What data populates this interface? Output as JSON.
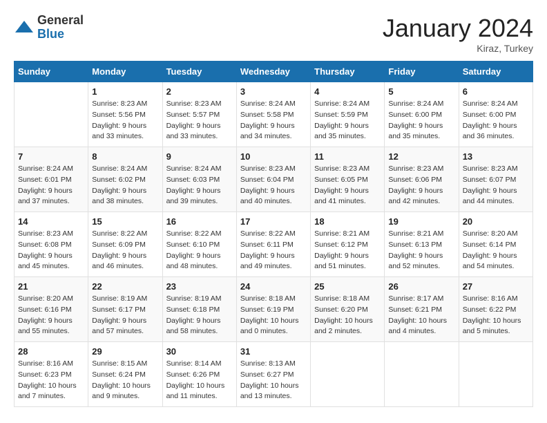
{
  "logo": {
    "general": "General",
    "blue": "Blue"
  },
  "title": "January 2024",
  "location": "Kiraz, Turkey",
  "days_of_week": [
    "Sunday",
    "Monday",
    "Tuesday",
    "Wednesday",
    "Thursday",
    "Friday",
    "Saturday"
  ],
  "weeks": [
    [
      {
        "day": "",
        "sunrise": "",
        "sunset": "",
        "daylight": ""
      },
      {
        "day": "1",
        "sunrise": "Sunrise: 8:23 AM",
        "sunset": "Sunset: 5:56 PM",
        "daylight": "Daylight: 9 hours and 33 minutes."
      },
      {
        "day": "2",
        "sunrise": "Sunrise: 8:23 AM",
        "sunset": "Sunset: 5:57 PM",
        "daylight": "Daylight: 9 hours and 33 minutes."
      },
      {
        "day": "3",
        "sunrise": "Sunrise: 8:24 AM",
        "sunset": "Sunset: 5:58 PM",
        "daylight": "Daylight: 9 hours and 34 minutes."
      },
      {
        "day": "4",
        "sunrise": "Sunrise: 8:24 AM",
        "sunset": "Sunset: 5:59 PM",
        "daylight": "Daylight: 9 hours and 35 minutes."
      },
      {
        "day": "5",
        "sunrise": "Sunrise: 8:24 AM",
        "sunset": "Sunset: 6:00 PM",
        "daylight": "Daylight: 9 hours and 35 minutes."
      },
      {
        "day": "6",
        "sunrise": "Sunrise: 8:24 AM",
        "sunset": "Sunset: 6:00 PM",
        "daylight": "Daylight: 9 hours and 36 minutes."
      }
    ],
    [
      {
        "day": "7",
        "sunrise": "Sunrise: 8:24 AM",
        "sunset": "Sunset: 6:01 PM",
        "daylight": "Daylight: 9 hours and 37 minutes."
      },
      {
        "day": "8",
        "sunrise": "Sunrise: 8:24 AM",
        "sunset": "Sunset: 6:02 PM",
        "daylight": "Daylight: 9 hours and 38 minutes."
      },
      {
        "day": "9",
        "sunrise": "Sunrise: 8:24 AM",
        "sunset": "Sunset: 6:03 PM",
        "daylight": "Daylight: 9 hours and 39 minutes."
      },
      {
        "day": "10",
        "sunrise": "Sunrise: 8:23 AM",
        "sunset": "Sunset: 6:04 PM",
        "daylight": "Daylight: 9 hours and 40 minutes."
      },
      {
        "day": "11",
        "sunrise": "Sunrise: 8:23 AM",
        "sunset": "Sunset: 6:05 PM",
        "daylight": "Daylight: 9 hours and 41 minutes."
      },
      {
        "day": "12",
        "sunrise": "Sunrise: 8:23 AM",
        "sunset": "Sunset: 6:06 PM",
        "daylight": "Daylight: 9 hours and 42 minutes."
      },
      {
        "day": "13",
        "sunrise": "Sunrise: 8:23 AM",
        "sunset": "Sunset: 6:07 PM",
        "daylight": "Daylight: 9 hours and 44 minutes."
      }
    ],
    [
      {
        "day": "14",
        "sunrise": "Sunrise: 8:23 AM",
        "sunset": "Sunset: 6:08 PM",
        "daylight": "Daylight: 9 hours and 45 minutes."
      },
      {
        "day": "15",
        "sunrise": "Sunrise: 8:22 AM",
        "sunset": "Sunset: 6:09 PM",
        "daylight": "Daylight: 9 hours and 46 minutes."
      },
      {
        "day": "16",
        "sunrise": "Sunrise: 8:22 AM",
        "sunset": "Sunset: 6:10 PM",
        "daylight": "Daylight: 9 hours and 48 minutes."
      },
      {
        "day": "17",
        "sunrise": "Sunrise: 8:22 AM",
        "sunset": "Sunset: 6:11 PM",
        "daylight": "Daylight: 9 hours and 49 minutes."
      },
      {
        "day": "18",
        "sunrise": "Sunrise: 8:21 AM",
        "sunset": "Sunset: 6:12 PM",
        "daylight": "Daylight: 9 hours and 51 minutes."
      },
      {
        "day": "19",
        "sunrise": "Sunrise: 8:21 AM",
        "sunset": "Sunset: 6:13 PM",
        "daylight": "Daylight: 9 hours and 52 minutes."
      },
      {
        "day": "20",
        "sunrise": "Sunrise: 8:20 AM",
        "sunset": "Sunset: 6:14 PM",
        "daylight": "Daylight: 9 hours and 54 minutes."
      }
    ],
    [
      {
        "day": "21",
        "sunrise": "Sunrise: 8:20 AM",
        "sunset": "Sunset: 6:16 PM",
        "daylight": "Daylight: 9 hours and 55 minutes."
      },
      {
        "day": "22",
        "sunrise": "Sunrise: 8:19 AM",
        "sunset": "Sunset: 6:17 PM",
        "daylight": "Daylight: 9 hours and 57 minutes."
      },
      {
        "day": "23",
        "sunrise": "Sunrise: 8:19 AM",
        "sunset": "Sunset: 6:18 PM",
        "daylight": "Daylight: 9 hours and 58 minutes."
      },
      {
        "day": "24",
        "sunrise": "Sunrise: 8:18 AM",
        "sunset": "Sunset: 6:19 PM",
        "daylight": "Daylight: 10 hours and 0 minutes."
      },
      {
        "day": "25",
        "sunrise": "Sunrise: 8:18 AM",
        "sunset": "Sunset: 6:20 PM",
        "daylight": "Daylight: 10 hours and 2 minutes."
      },
      {
        "day": "26",
        "sunrise": "Sunrise: 8:17 AM",
        "sunset": "Sunset: 6:21 PM",
        "daylight": "Daylight: 10 hours and 4 minutes."
      },
      {
        "day": "27",
        "sunrise": "Sunrise: 8:16 AM",
        "sunset": "Sunset: 6:22 PM",
        "daylight": "Daylight: 10 hours and 5 minutes."
      }
    ],
    [
      {
        "day": "28",
        "sunrise": "Sunrise: 8:16 AM",
        "sunset": "Sunset: 6:23 PM",
        "daylight": "Daylight: 10 hours and 7 minutes."
      },
      {
        "day": "29",
        "sunrise": "Sunrise: 8:15 AM",
        "sunset": "Sunset: 6:24 PM",
        "daylight": "Daylight: 10 hours and 9 minutes."
      },
      {
        "day": "30",
        "sunrise": "Sunrise: 8:14 AM",
        "sunset": "Sunset: 6:26 PM",
        "daylight": "Daylight: 10 hours and 11 minutes."
      },
      {
        "day": "31",
        "sunrise": "Sunrise: 8:13 AM",
        "sunset": "Sunset: 6:27 PM",
        "daylight": "Daylight: 10 hours and 13 minutes."
      },
      {
        "day": "",
        "sunrise": "",
        "sunset": "",
        "daylight": ""
      },
      {
        "day": "",
        "sunrise": "",
        "sunset": "",
        "daylight": ""
      },
      {
        "day": "",
        "sunrise": "",
        "sunset": "",
        "daylight": ""
      }
    ]
  ]
}
